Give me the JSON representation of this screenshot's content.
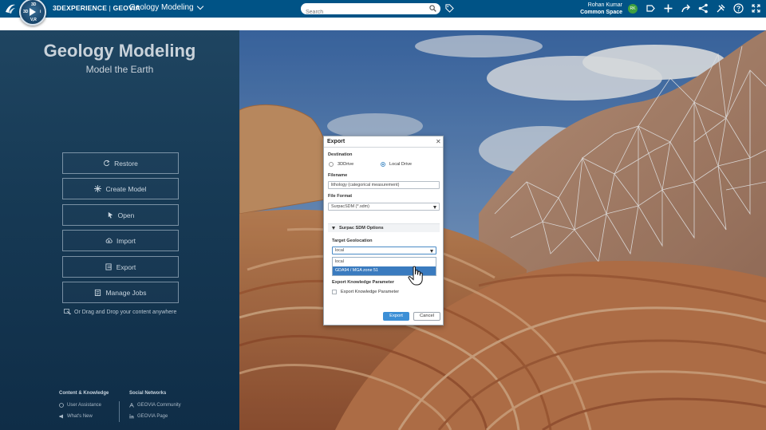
{
  "topbar": {
    "brand_prefix": "3DEXPERIENCE",
    "brand_separator": " | ",
    "brand_company": "GEOVIA",
    "app_title": "Geology Modeling",
    "search_placeholder": "Search",
    "user_name": "Rohan Kumar",
    "workspace": "Common Space",
    "avatar_initials": "RK",
    "accent_color": "#005386",
    "compass_labels": {
      "north": "3D",
      "west": "3D",
      "east": "i",
      "south": "V,R"
    }
  },
  "left_panel": {
    "title": "Geology Modeling",
    "subtitle": "Model the Earth",
    "buttons": [
      {
        "label": "Restore",
        "icon": "restore-icon"
      },
      {
        "label": "Create Model",
        "icon": "sparkle-icon"
      },
      {
        "label": "Open",
        "icon": "open-icon"
      },
      {
        "label": "Import",
        "icon": "upload-icon"
      },
      {
        "label": "Export",
        "icon": "export-icon"
      },
      {
        "label": "Manage Jobs",
        "icon": "jobs-icon"
      }
    ],
    "drag_drop_text": "Or Drag and Drop your content anywhere",
    "footer": {
      "content_heading": "Content & Knowledge",
      "content_links": [
        "User Assistance",
        "What's New"
      ],
      "social_heading": "Social Networks",
      "social_links": [
        "GEOVIA Community",
        "GEOVIA Page"
      ]
    }
  },
  "dialog": {
    "title": "Export",
    "destination_label": "Destination",
    "destination_options": [
      "3DDrive",
      "Local Drive"
    ],
    "destination_selected": "Local Drive",
    "filename_label": "Filename",
    "filename_value": "lithology (categorical measurement)",
    "file_format_label": "File Format",
    "file_format_value": "SurpacSDM (*.sdm)",
    "section_title": "Surpac SDM Options",
    "geolocation_label": "Target Geolocation",
    "geolocation_value": "local",
    "geolocation_options": [
      "local",
      "GDA94 / MGA zone 51"
    ],
    "geolocation_highlighted": "GDA94 / MGA zone 51",
    "knowledge_label": "Export Knowledge Parameter",
    "knowledge_checkbox_label": "Export Knowledge Parameter",
    "knowledge_checked": false,
    "export_button": "Export",
    "cancel_button": "Cancel",
    "primary_color": "#3c8fd6"
  }
}
